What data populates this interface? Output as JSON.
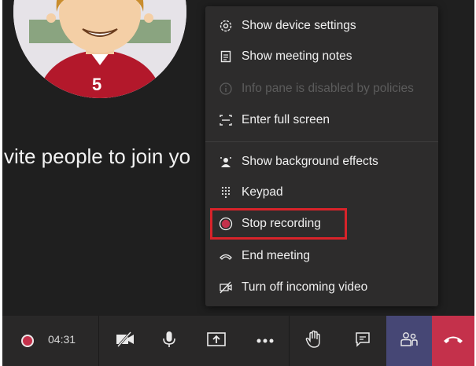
{
  "meeting": {
    "invite_text": "vite people to join yo",
    "avatar_jersey_number": "5"
  },
  "menu": {
    "items": [
      {
        "label": "Show device settings",
        "icon": "gear-icon",
        "enabled": true
      },
      {
        "label": "Show meeting notes",
        "icon": "notes-icon",
        "enabled": true
      },
      {
        "label": "Info pane is disabled by policies",
        "icon": "info-icon",
        "enabled": false
      },
      {
        "label": "Enter full screen",
        "icon": "fullscreen-icon",
        "enabled": true
      },
      {
        "label": "Show background effects",
        "icon": "background-effects-icon",
        "enabled": true
      },
      {
        "label": "Keypad",
        "icon": "keypad-icon",
        "enabled": true
      },
      {
        "label": "Stop recording",
        "icon": "record-icon",
        "enabled": true,
        "highlighted": true
      },
      {
        "label": "End meeting",
        "icon": "hang-up-icon",
        "enabled": true
      },
      {
        "label": "Turn off incoming video",
        "icon": "video-off-icon",
        "enabled": true
      }
    ]
  },
  "toolbar": {
    "timer": "04:31",
    "buttons": [
      "record-indicator-icon",
      "camera-off-icon",
      "microphone-icon",
      "share-screen-icon",
      "more-actions-icon",
      "raise-hand-icon",
      "chat-icon",
      "participants-icon",
      "hang-up-icon"
    ]
  },
  "colors": {
    "menu_bg": "#2d2c2c",
    "highlight_border": "#d8232a",
    "record_red": "#c4314b",
    "hangup_bg": "#c4314b",
    "participants_active_bg": "#464775"
  }
}
